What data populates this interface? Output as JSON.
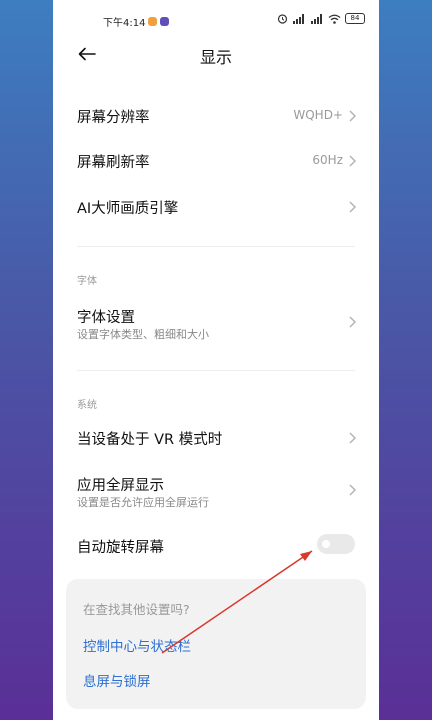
{
  "status_bar": {
    "time": "下午4:14",
    "battery": "84"
  },
  "header": {
    "back_icon": "back-arrow-icon",
    "title": "显示"
  },
  "settings": [
    {
      "title": "屏幕分辨率",
      "value": "WQHD+"
    },
    {
      "title": "屏幕刷新率",
      "value": "60Hz"
    },
    {
      "title": "AI大师画质引擎",
      "value": ""
    }
  ],
  "font_section": {
    "label": "字体",
    "item": {
      "title": "字体设置",
      "subtitle": "设置字体类型、粗细和大小"
    }
  },
  "system_section": {
    "label": "系统",
    "items": [
      {
        "title": "当设备处于 VR 模式时",
        "subtitle": ""
      },
      {
        "title": "应用全屏显示",
        "subtitle": "设置是否允许应用全屏运行"
      }
    ],
    "auto_rotate": {
      "title": "自动旋转屏幕",
      "enabled": false
    }
  },
  "suggestion_card": {
    "title": "在查找其他设置吗?",
    "links": [
      "控制中心与状态栏",
      "息屏与锁屏"
    ]
  },
  "colors": {
    "accent": "#2d6fd2",
    "annotation": "#d9382c"
  }
}
